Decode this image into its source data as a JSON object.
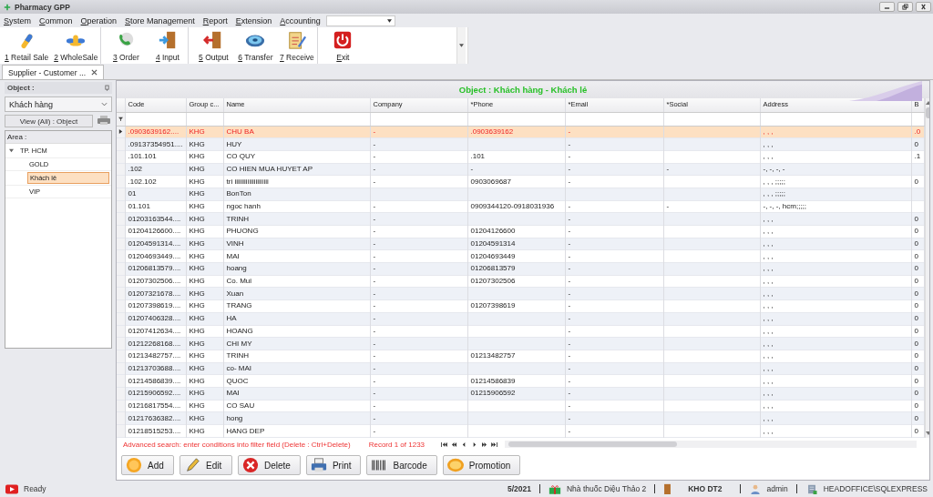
{
  "window": {
    "title": "Pharmacy GPP"
  },
  "menu": [
    "System",
    "Common",
    "Operation",
    "Store Management",
    "Report",
    "Extension",
    "Accounting"
  ],
  "toolbar": [
    {
      "label": "1 Retail Sale",
      "kind": "capsule",
      "group_end": false
    },
    {
      "label": "2 WholeSale",
      "kind": "pills",
      "group_end": true
    },
    {
      "label": "3 Order",
      "kind": "phone",
      "group_end": false
    },
    {
      "label": "4 Input",
      "kind": "door-in",
      "group_end": true
    },
    {
      "label": "5 Output",
      "kind": "door-out",
      "group_end": false
    },
    {
      "label": "6 Transfer",
      "kind": "disc",
      "group_end": false
    },
    {
      "label": "7 Receive",
      "kind": "clipboard",
      "group_end": true
    },
    {
      "label": "Exit",
      "kind": "power",
      "group_end": false
    }
  ],
  "tabs": [
    {
      "label": "Supplier - Customer ...",
      "selected": true
    }
  ],
  "object_panel": {
    "title": "Object :",
    "dropdown": "Khách hàng",
    "view_button": "View (All) : Object",
    "tree_title": "Area :",
    "tree": [
      {
        "label": "TP. HCM",
        "expanded": true,
        "selected": false,
        "children": [
          {
            "label": "GOLD",
            "selected": false
          },
          {
            "label": "Khách lẻ",
            "selected": true
          },
          {
            "label": "VIP",
            "selected": false
          }
        ]
      }
    ]
  },
  "grid": {
    "title": "Object : Khách hàng - Khách lẻ",
    "columns": [
      "Code",
      "Group c...",
      "Name",
      "Company",
      "*Phone",
      "*Email",
      "*Social",
      "Address",
      "B"
    ],
    "rows": [
      {
        "selected": true,
        "cells": [
          ".0903639162....",
          "KHG",
          "CHU BA",
          "-",
          ".0903639162",
          "-",
          "",
          ", , ,",
          ".0"
        ]
      },
      {
        "selected": false,
        "cells": [
          ".09137354951....",
          "KHG",
          "HUY",
          "-",
          "",
          "-",
          "",
          ", , ,",
          "0"
        ]
      },
      {
        "selected": false,
        "cells": [
          ".101.101",
          "KHG",
          "CO QUY",
          "-",
          ".101",
          "-",
          "",
          ", , ,",
          ".1"
        ]
      },
      {
        "selected": false,
        "cells": [
          ".102",
          "KHG",
          "CO HIEN MUA HUYET AP",
          "-",
          "-",
          "-",
          "-",
          "-, -, -, -",
          ""
        ]
      },
      {
        "selected": false,
        "cells": [
          ".102.102",
          "KHG",
          "tri iiiiiiiiiiiiiiiiiiiii",
          "-",
          "0903069687",
          "-",
          "",
          ", , , ;;;;;",
          "0"
        ]
      },
      {
        "selected": false,
        "cells": [
          "01",
          "KHG",
          "BonTon",
          "",
          "",
          "",
          "",
          ", , , ;;;;;",
          ""
        ]
      },
      {
        "selected": false,
        "cells": [
          "01.101",
          "KHG",
          "ngoc hanh",
          "-",
          "0909344120-0918031936",
          "-",
          "-",
          "-, -, -, hcm;;;;;",
          ""
        ]
      },
      {
        "selected": false,
        "cells": [
          "01203163544....",
          "KHG",
          "TRINH",
          "-",
          "",
          "-",
          "",
          ", , ,",
          "0"
        ]
      },
      {
        "selected": false,
        "cells": [
          "01204126600....",
          "KHG",
          "PHUONG",
          "-",
          "01204126600",
          "-",
          "",
          ", , ,",
          "0"
        ]
      },
      {
        "selected": false,
        "cells": [
          "01204591314....",
          "KHG",
          "VINH",
          "-",
          "01204591314",
          "-",
          "",
          ", , ,",
          "0"
        ]
      },
      {
        "selected": false,
        "cells": [
          "01204693449....",
          "KHG",
          "MAI",
          "-",
          "01204693449",
          "-",
          "",
          ", , ,",
          "0"
        ]
      },
      {
        "selected": false,
        "cells": [
          "01206813579....",
          "KHG",
          "hoang",
          "-",
          "01206813579",
          "-",
          "",
          ", , ,",
          "0"
        ]
      },
      {
        "selected": false,
        "cells": [
          "01207302506....",
          "KHG",
          "Co. Mui",
          "-",
          "01207302506",
          "-",
          "",
          ", , ,",
          "0"
        ]
      },
      {
        "selected": false,
        "cells": [
          "01207321678....",
          "KHG",
          "Xuan",
          "-",
          "",
          "-",
          "",
          ", , ,",
          "0"
        ]
      },
      {
        "selected": false,
        "cells": [
          "01207398619....",
          "KHG",
          "TRANG",
          "-",
          "01207398619",
          "-",
          "",
          ", , ,",
          "0"
        ]
      },
      {
        "selected": false,
        "cells": [
          "01207406328....",
          "KHG",
          "HA",
          "-",
          "",
          "-",
          "",
          ", , ,",
          "0"
        ]
      },
      {
        "selected": false,
        "cells": [
          "01207412634....",
          "KHG",
          "HOANG",
          "-",
          "",
          "-",
          "",
          ", , ,",
          "0"
        ]
      },
      {
        "selected": false,
        "cells": [
          "01212268168....",
          "KHG",
          "CHI MY",
          "-",
          "",
          "-",
          "",
          ", , ,",
          "0"
        ]
      },
      {
        "selected": false,
        "cells": [
          "01213482757....",
          "KHG",
          "TRINH",
          "-",
          "01213482757",
          "-",
          "",
          ", , ,",
          "0"
        ]
      },
      {
        "selected": false,
        "cells": [
          "01213703688....",
          "KHG",
          "co- MAI",
          "-",
          "",
          "-",
          "",
          ", , ,",
          "0"
        ]
      },
      {
        "selected": false,
        "cells": [
          "01214586839....",
          "KHG",
          "QUOC",
          "-",
          "01214586839",
          "-",
          "",
          ", , ,",
          "0"
        ]
      },
      {
        "selected": false,
        "cells": [
          "01215906592....",
          "KHG",
          "MAI",
          "-",
          "01215906592",
          "-",
          "",
          ", , ,",
          "0"
        ]
      },
      {
        "selected": false,
        "cells": [
          "01216817554....",
          "KHG",
          "CO SAU",
          "-",
          "",
          "-",
          "",
          ", , ,",
          "0"
        ]
      },
      {
        "selected": false,
        "cells": [
          "01217636382....",
          "KHG",
          "hong",
          "-",
          "",
          "-",
          "",
          ", , ,",
          "0"
        ]
      },
      {
        "selected": false,
        "cells": [
          "01218515253....",
          "KHG",
          "HANG DEP",
          "-",
          "",
          "-",
          "",
          ", , ,",
          "0"
        ]
      }
    ],
    "hint": "Advanced search: enter conditions into filter field (Delete : Ctrl+Delete)",
    "record": "Record 1 of 1233"
  },
  "actions": [
    {
      "label": "Add",
      "kind": "add"
    },
    {
      "label": "Edit",
      "kind": "edit"
    },
    {
      "label": "Delete",
      "kind": "delete"
    },
    {
      "label": "Print",
      "kind": "print"
    },
    {
      "label": "Barcode",
      "kind": "barcode"
    },
    {
      "label": "Promotion",
      "kind": "promotion"
    }
  ],
  "status_bar": {
    "status": "Ready",
    "period": "5/2021",
    "store": "Nhà thuốc Diệu Thảo 2",
    "warehouse": "KHO DT2",
    "user": "admin",
    "server": "HEADOFFICE\\SQLEXPRESS"
  }
}
